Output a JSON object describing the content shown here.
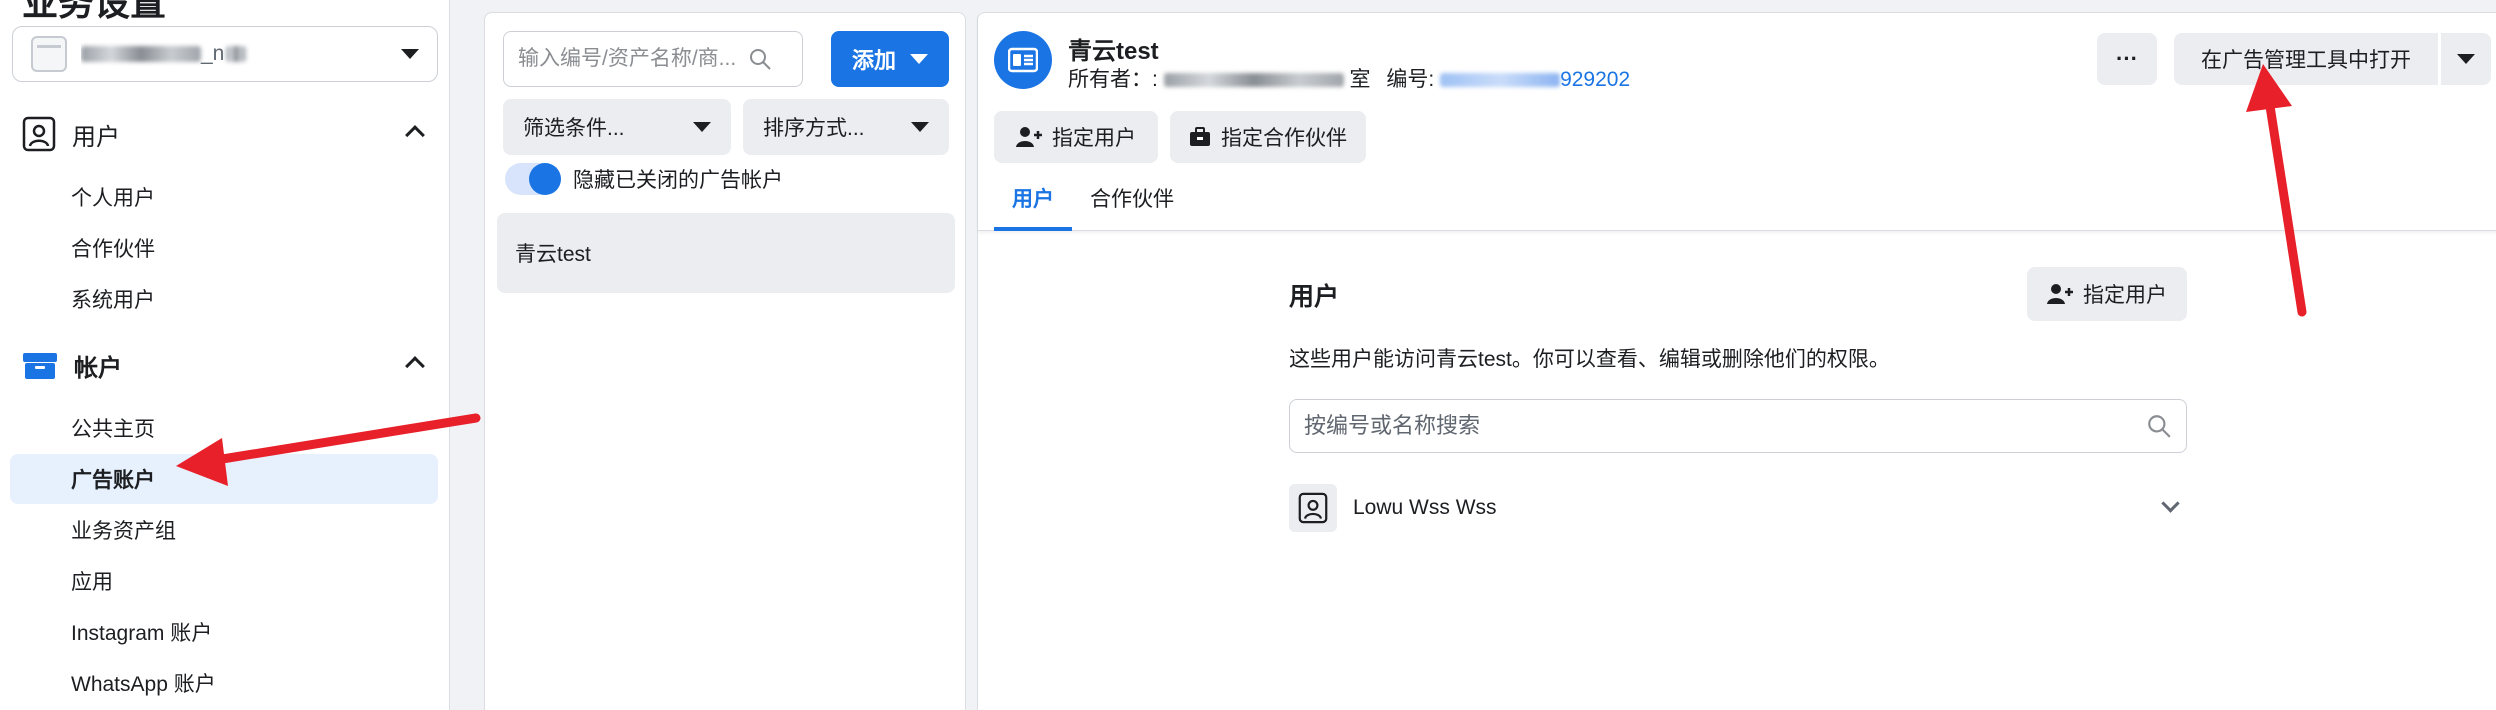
{
  "sidebar": {
    "title": "业务设置",
    "business_name": "_n",
    "sections": [
      {
        "label": "用户",
        "icon": "person-badge-icon",
        "items": [
          "个人用户",
          "合作伙伴",
          "系统用户"
        ]
      },
      {
        "label": "帐户",
        "icon": "briefcase-icon",
        "items": [
          "公共主页",
          "广告账户",
          "业务资产组",
          "应用",
          "Instagram 账户",
          "WhatsApp 账户"
        ]
      }
    ],
    "active_item": "广告账户"
  },
  "list": {
    "search_placeholder": "输入编号/资产名称/商...",
    "add_label": "添加",
    "filter_label": "筛选条件...",
    "sort_label": "排序方式...",
    "toggle_label": "隐藏已关闭的广告帐户",
    "toggle_on": true,
    "assets": [
      "青云test"
    ]
  },
  "detail": {
    "account_name": "青云test",
    "owner_label": "所有者：:",
    "owner_suffix": "室",
    "id_label": "编号:",
    "id_value": "929202",
    "more_label": "···",
    "open_label": "在广告管理工具中打开",
    "assign_user_label": "指定用户",
    "assign_partner_label": "指定合作伙伴",
    "tabs": [
      "用户",
      "合作伙伴"
    ],
    "active_tab": "用户",
    "users_title": "用户",
    "users_assign_label": "指定用户",
    "users_desc": "这些用户能访问青云test。你可以查看、编辑或删除他们的权限。",
    "users_search_placeholder": "按编号或名称搜索",
    "users": [
      {
        "name": "Lowu Wss Wss"
      }
    ]
  },
  "colors": {
    "accent": "#1b74e4",
    "annotation": "#e8202a",
    "active_bg": "#e7f0fd"
  }
}
